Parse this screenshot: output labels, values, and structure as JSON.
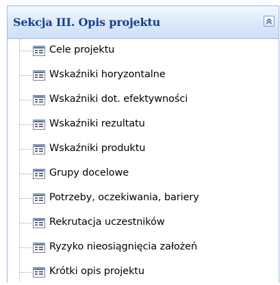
{
  "panel": {
    "title": "Sekcja III. Opis projektu",
    "collapse_icon": "double-chevron-up-icon"
  },
  "tree": {
    "leaf_icon": "form-document-icon",
    "items": [
      {
        "label": "Cele projektu"
      },
      {
        "label": "Wskaźniki horyzontalne"
      },
      {
        "label": "Wskaźniki dot. efektywności"
      },
      {
        "label": "Wskaźniki rezultatu"
      },
      {
        "label": "Wskaźniki produktu"
      },
      {
        "label": "Grupy docelowe"
      },
      {
        "label": "Potrzeby, oczekiwania, bariery"
      },
      {
        "label": "Rekrutacja uczestników"
      },
      {
        "label": "Ryzyko nieosiągnięcia założeń"
      },
      {
        "label": "Krótki opis projektu"
      }
    ]
  },
  "colors": {
    "header_text": "#15428b",
    "border": "#99bbe8",
    "header_gradient_top": "#f3f8ff",
    "header_gradient_bottom": "#cfdff7"
  }
}
